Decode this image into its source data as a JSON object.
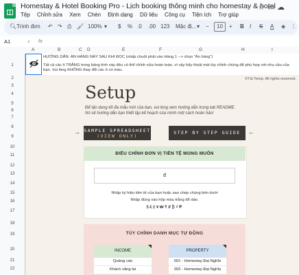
{
  "window": {
    "title": "Homestay & Hotel Booking Pro - Lịch booking thông minh cho homestay & hotel"
  },
  "menu": [
    "Tệp",
    "Chỉnh sửa",
    "Xem",
    "Chèn",
    "Định dạng",
    "Dữ liệu",
    "Công cụ",
    "Tiện ích",
    "Trợ giúp"
  ],
  "toolbar": {
    "search_label": "Trình đơn",
    "zoom": "100%",
    "currency": "$",
    "percent": "%",
    "decrease_decimal": ".0",
    "increase_decimal": ".00",
    "number_format": "123",
    "font": "Mặc đị...",
    "font_size": "10",
    "bold": "B",
    "italic": "I",
    "strike": "S",
    "text_color": "A"
  },
  "formula_bar": {
    "cell_ref": "A1",
    "fx": "fx"
  },
  "columns": [
    "A",
    "B",
    "C",
    "D",
    "E",
    "F",
    "G",
    "H",
    "I"
  ],
  "rows": [
    "1",
    "2",
    "3",
    "4",
    "5",
    "6",
    "7",
    "8",
    "9",
    "10",
    "11",
    "12",
    "13",
    "14",
    "15",
    "16",
    "17",
    "18",
    "19",
    "20",
    "21",
    "22"
  ],
  "sheet": {
    "hint_line1": "HƯỚNG DẪN: ẨN HÀNG NÀY SAU KHI ĐỌC (nhấp chuột phải vào Hàng 1 --> chọn \"Ẩn hàng\")",
    "hint_line2": "Tất cả các ô TRẮNG trong bảng tính này đều có thể chỉnh sửa hoàn toàn. vì vậy hãy thoải mái tùy chỉnh chúng để phù hợp với nhu cầu của bạn. Vui lòng KHÔNG thay đổi các ô có màu.",
    "copyright": "©Tải Temp. All rights reserved.",
    "setup_title": "Setup",
    "setup_desc1": "Để tận dụng tối đa mẫu mới của bạn, vui lòng xem hướng dẫn trong tab README.",
    "setup_desc2": "Nó sẽ hướng dẫn bạn thiết lập kế hoạch của mình một cách hoàn hảo!",
    "sample_btn_line1": "SAMPLE SPREADSHEET",
    "sample_btn_line2": "(VIEW ONLY)",
    "guide_btn": "STEP BY STEP GUIDE",
    "arrow_left": "→",
    "arrow_right": "←",
    "currency_head": "ĐIỀU CHỈNH ĐƠN VỊ TIỀN TỆ MONG MUỐN",
    "currency_value": "đ",
    "currency_note1": "Nhập ký hiệu tiền tệ của bạn hoặc sao chép chúng bên dưới",
    "currency_note2": "Nhập đúng vào hộp màu trắng để dán.",
    "currency_symbols": "$€£¥₩₹₽₿₫₱",
    "category_title": "TÙY CHỈNH DANH MỤC TỰ ĐỘNG",
    "income_head": "INCOME",
    "property_head": "PROPERTY",
    "income_items": [
      "Quảng cáo",
      "Khách vãng lai"
    ],
    "property_items": [
      "001 - Homestay Đại Nghĩa",
      "002 - Homestay Đại Nghĩa"
    ]
  }
}
